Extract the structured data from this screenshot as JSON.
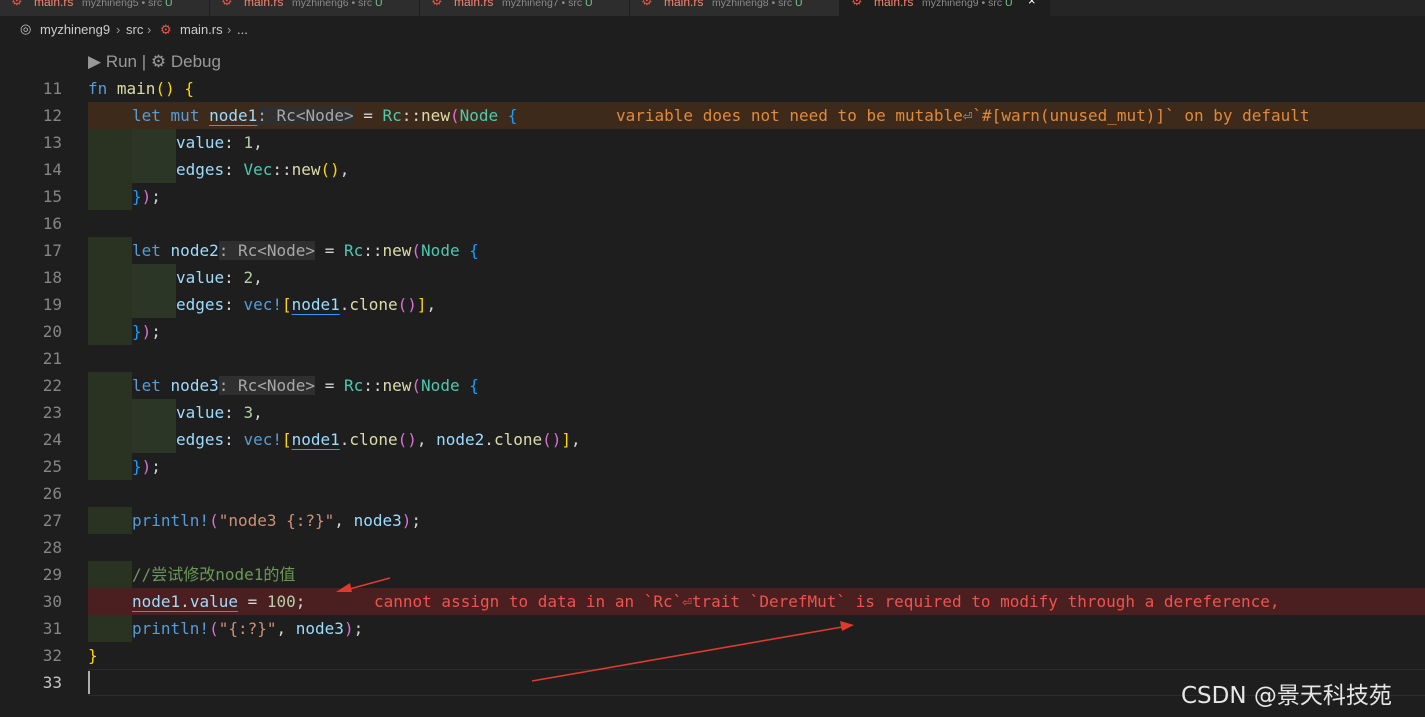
{
  "tabs": [
    {
      "icon": "rust-file-icon",
      "name": "main.rs",
      "path": "myzhineng5 • src",
      "status": "U"
    },
    {
      "icon": "rust-file-icon",
      "name": "main.rs",
      "path": "myzhineng6 • src",
      "status": "U"
    },
    {
      "icon": "rust-file-icon",
      "name": "main.rs",
      "path": "myzhineng7 • src",
      "status": "U"
    },
    {
      "icon": "rust-file-icon",
      "name": "main.rs",
      "path": "myzhineng8 • src",
      "status": "U"
    },
    {
      "icon": "rust-file-icon",
      "name": "main.rs",
      "path": "myzhineng9 • src",
      "status": "U",
      "close": "×"
    }
  ],
  "breadcrumb": {
    "icon": "project-icon",
    "items": [
      "myzhineng9",
      "src",
      "main.rs",
      "..."
    ],
    "separator": "›"
  },
  "codelens": {
    "run": "Run",
    "separator": "|",
    "debug": "Debug"
  },
  "line_numbers": [
    "11",
    "12",
    "13",
    "14",
    "15",
    "16",
    "17",
    "18",
    "19",
    "20",
    "21",
    "22",
    "23",
    "24",
    "25",
    "26",
    "27",
    "28",
    "29",
    "30",
    "31",
    "32",
    "33"
  ],
  "code": {
    "l11": {
      "fn": "fn",
      "main": "main",
      "p1": "()",
      "sp": " ",
      "b": "{"
    },
    "l12": {
      "let": "let",
      "mut": "mut",
      "var": "node1",
      "hint_colon": ":",
      "hint_type": "Rc<Node>",
      "eq": " = ",
      "rc": "Rc",
      "sep": "::",
      "new": "new",
      "paren": "(",
      "node": "Node",
      "brace": "{",
      "diag": "variable does not need to be mutable⏎`#[warn(unused_mut)]` on by default"
    },
    "l13": {
      "field": "value",
      "colon": ": ",
      "num": "1",
      "comma": ","
    },
    "l14": {
      "field": "edges",
      "colon": ": ",
      "vec": "Vec",
      "sep": "::",
      "new": "new",
      "paren": "()",
      "comma": ","
    },
    "l15": {
      "brace": "}",
      "paren": ")",
      "semi": ";"
    },
    "l17": {
      "let": "let",
      "var": "node2",
      "hint_colon": ":",
      "hint_type": "Rc<Node>",
      "eq": " = ",
      "rc": "Rc",
      "sep": "::",
      "new": "new",
      "paren": "(",
      "node": "Node",
      "brace": "{"
    },
    "l18": {
      "field": "value",
      "colon": ": ",
      "num": "2",
      "comma": ","
    },
    "l19": {
      "field": "edges",
      "colon": ": ",
      "vec": "vec!",
      "bracket": "[",
      "arg": "node1",
      "dot": ".",
      "clone": "clone",
      "paren": "()",
      "bracket_close": "]",
      "comma": ","
    },
    "l20": {
      "brace": "}",
      "paren": ")",
      "semi": ";"
    },
    "l22": {
      "let": "let",
      "var": "node3",
      "hint_colon": ":",
      "hint_type": "Rc<Node>",
      "eq": " = ",
      "rc": "Rc",
      "sep": "::",
      "new": "new",
      "paren": "(",
      "node": "Node",
      "brace": "{"
    },
    "l23": {
      "field": "value",
      "colon": ": ",
      "num": "3",
      "comma": ","
    },
    "l24": {
      "field": "edges",
      "colon": ": ",
      "vec": "vec!",
      "bracket": "[",
      "arg": "node1",
      "dot": ".",
      "clone": "clone",
      "paren": "()",
      "sep2": ", ",
      "arg2": "node2",
      "dot2": ".",
      "clone2": "clone",
      "paren2": "()",
      "bracket_close": "]",
      "comma": ","
    },
    "l25": {
      "brace": "}",
      "paren": ")",
      "semi": ";"
    },
    "l27": {
      "mac": "println!",
      "p_open": "(",
      "str": "\"node3 {:?}\"",
      "comma": ", ",
      "arg": "node3",
      "p_close": ")",
      "semi": ";"
    },
    "l29": {
      "comment": "//尝试修改node1的值"
    },
    "l30": {
      "var": "node1",
      "dot": ".",
      "field": "value",
      "eq": " = ",
      "num": "100",
      "semi": ";",
      "diag": "cannot assign to data in an `Rc`⏎trait `DerefMut` is required to modify through a dereference,"
    },
    "l31": {
      "mac": "println!",
      "p_open": "(",
      "str": "\"{:?}\"",
      "comma": ", ",
      "arg": "node3",
      "p_close": ")",
      "semi": ";"
    },
    "l32": {
      "brace": "}"
    }
  },
  "colors": {
    "warning": "#e08a3c",
    "error": "#f2524e",
    "annotation_arrow": "#e03a2e"
  },
  "watermark": "CSDN @景天科技苑"
}
